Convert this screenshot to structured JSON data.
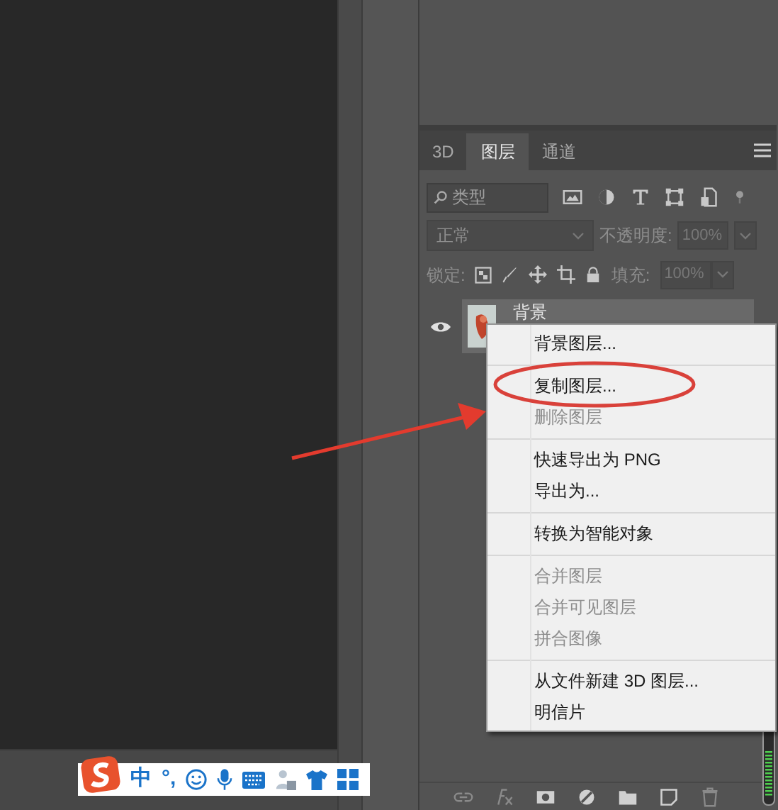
{
  "panel": {
    "tabs": [
      {
        "label": "3D",
        "selected": false
      },
      {
        "label": "图层",
        "selected": true
      },
      {
        "label": "通道",
        "selected": false
      }
    ],
    "filter": {
      "placeholder": "类型"
    },
    "blend_mode": "正常",
    "opacity_label": "不透明度:",
    "opacity": "100%",
    "lock_label": "锁定:",
    "fill_label": "填充:",
    "fill": "100%",
    "layers": [
      {
        "name": "背景",
        "visible": true
      }
    ]
  },
  "context_menu": {
    "groups": [
      [
        {
          "label": "背景图层...",
          "disabled": false
        }
      ],
      [
        {
          "label": "复制图层...",
          "disabled": false
        },
        {
          "label": "删除图层",
          "disabled": true
        }
      ],
      [
        {
          "label": "快速导出为 PNG",
          "disabled": false
        },
        {
          "label": "导出为...",
          "disabled": false
        }
      ],
      [
        {
          "label": "转换为智能对象",
          "disabled": false
        }
      ],
      [
        {
          "label": "合并图层",
          "disabled": true
        },
        {
          "label": "合并可见图层",
          "disabled": true
        },
        {
          "label": "拼合图像",
          "disabled": true
        }
      ],
      [
        {
          "label": "从文件新建 3D 图层...",
          "disabled": false
        },
        {
          "label": "明信片",
          "disabled": false
        }
      ]
    ]
  },
  "ime_toolbar": {
    "items": [
      {
        "label": "中"
      },
      {
        "label": "°,"
      }
    ]
  }
}
